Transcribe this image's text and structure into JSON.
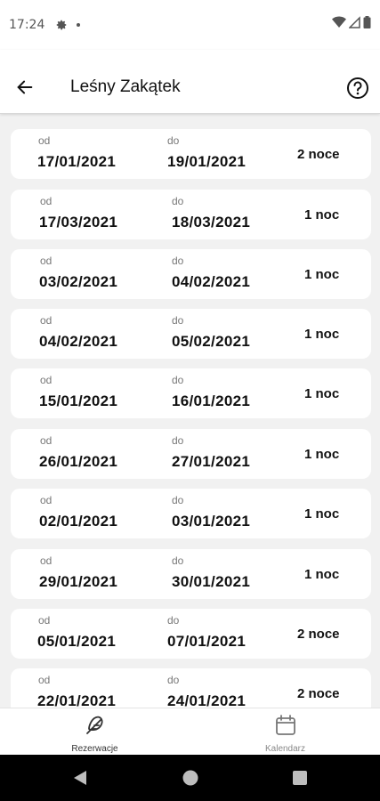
{
  "status_bar": {
    "time": "17:24"
  },
  "header": {
    "title": "Leśny Zakątek"
  },
  "labels": {
    "from": "od",
    "to": "do"
  },
  "reservations": [
    {
      "from": "17/01/2021",
      "to": "19/01/2021",
      "nights": "2 noce"
    },
    {
      "from": "17/03/2021",
      "to": "18/03/2021",
      "nights": "1 noc"
    },
    {
      "from": "03/02/2021",
      "to": "04/02/2021",
      "nights": "1 noc"
    },
    {
      "from": "04/02/2021",
      "to": "05/02/2021",
      "nights": "1 noc"
    },
    {
      "from": "15/01/2021",
      "to": "16/01/2021",
      "nights": "1 noc"
    },
    {
      "from": "26/01/2021",
      "to": "27/01/2021",
      "nights": "1 noc"
    },
    {
      "from": "02/01/2021",
      "to": "03/01/2021",
      "nights": "1 noc"
    },
    {
      "from": "29/01/2021",
      "to": "30/01/2021",
      "nights": "1 noc"
    },
    {
      "from": "05/01/2021",
      "to": "07/01/2021",
      "nights": "2 noce"
    },
    {
      "from": "22/01/2021",
      "to": "24/01/2021",
      "nights": "2 noce"
    }
  ],
  "bottom_nav": {
    "reservations_label": "Rezerwacje",
    "calendar_label": "Kalendarz"
  },
  "icons": {
    "back": "arrow-back-icon",
    "help": "help-circle-icon",
    "reservations": "feather-icon",
    "calendar": "calendar-icon"
  },
  "colors": {
    "background": "#f1f1f1",
    "card": "#ffffff",
    "system_nav": "#000000"
  }
}
